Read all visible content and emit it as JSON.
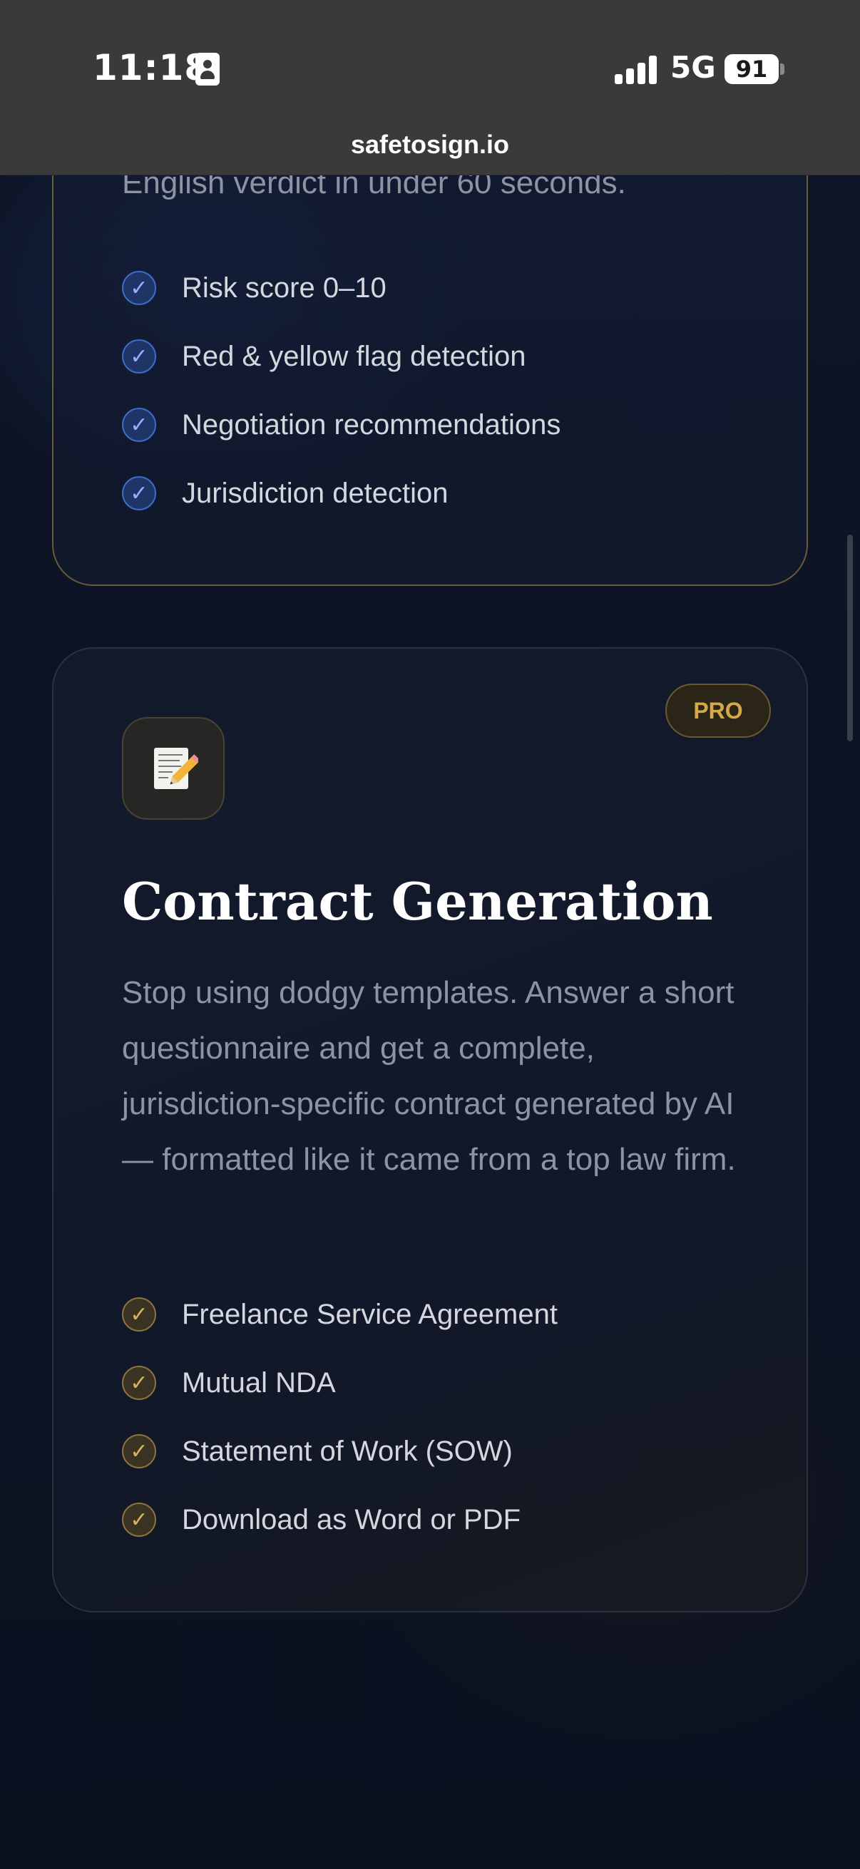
{
  "status_bar": {
    "time": "11:18",
    "network": "5G",
    "battery": "91"
  },
  "browser": {
    "url": "safetosign.io"
  },
  "analysis_card": {
    "lead_text": "English verdict in under 60 seconds.",
    "features": [
      "Risk score 0–10",
      "Red & yellow flag detection",
      "Negotiation recommendations",
      "Jurisdiction detection"
    ]
  },
  "generation_card": {
    "badge": "PRO",
    "icon": "memo-pencil-icon",
    "title": "Contract Generation",
    "description": "Stop using dodgy templates. Answer a short questionnaire and get a complete, jurisdiction-specific contract generated by AI — formatted like it came from a top law firm.",
    "features": [
      "Freelance Service Agreement",
      "Mutual NDA",
      "Statement of Work (SOW)",
      "Download as Word or PDF"
    ]
  },
  "colors": {
    "background": "#0b1120",
    "accent_gold": "#d4a94c",
    "accent_blue": "#3d6bc9"
  }
}
